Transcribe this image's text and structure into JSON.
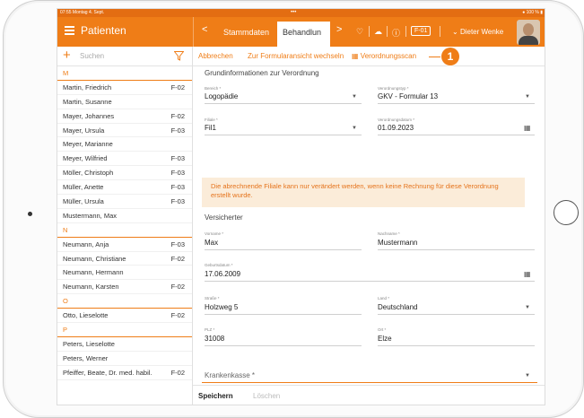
{
  "status": {
    "time_date": "07:55  Montag 4. Sept.",
    "dots": "•••",
    "battery": "100 %"
  },
  "app": {
    "title": "Patienten"
  },
  "nav": {
    "back": "<",
    "forward": ">",
    "tabs": [
      {
        "label": "Stammdaten"
      },
      {
        "label": "Behandlun"
      }
    ],
    "badge": "F-01",
    "user": "Dieter Wenke"
  },
  "search": {
    "placeholder": "Suchen"
  },
  "patients": [
    {
      "type": "letter",
      "name": "M"
    },
    {
      "name": "Martin, Friedrich",
      "code": "F-02"
    },
    {
      "name": "Martin, Susanne",
      "code": ""
    },
    {
      "name": "Mayer, Johannes",
      "code": "F-02"
    },
    {
      "name": "Mayer, Ursula",
      "code": "F-03"
    },
    {
      "name": "Meyer, Marianne",
      "code": ""
    },
    {
      "name": "Meyer, Wilfried",
      "code": "F-03"
    },
    {
      "name": "Möller, Christoph",
      "code": "F-03"
    },
    {
      "name": "Müller, Anette",
      "code": "F-03"
    },
    {
      "name": "Müller, Ursula",
      "code": "F-03"
    },
    {
      "name": "Mustermann, Max",
      "code": ""
    },
    {
      "type": "letter",
      "name": "N"
    },
    {
      "name": "Neumann, Anja",
      "code": "F-03"
    },
    {
      "name": "Neumann, Christiane",
      "code": "F-02"
    },
    {
      "name": "Neumann, Hermann",
      "code": ""
    },
    {
      "name": "Neumann, Karsten",
      "code": "F-02"
    },
    {
      "type": "letter",
      "name": "O"
    },
    {
      "name": "Otto, Lieselotte",
      "code": "F-02"
    },
    {
      "type": "letter",
      "name": "P"
    },
    {
      "name": "Peters, Lieselotte",
      "code": ""
    },
    {
      "name": "Peters, Werner",
      "code": ""
    },
    {
      "name": "Pfeiffer, Beate, Dr. med. habil.",
      "code": "F-02"
    }
  ],
  "toolbar": {
    "cancel": "Abbrechen",
    "switch_form": "Zur Formularansicht wechseln",
    "scan": "Verordnungsscan",
    "callout": "1"
  },
  "form": {
    "section_basic": "Grundinformationen zur Verordnung",
    "bereich": {
      "label": "Bereich *",
      "value": "Logopädie"
    },
    "typ": {
      "label": "Verordnungstyp *",
      "value": "GKV - Formular 13"
    },
    "filiale": {
      "label": "Filiale *",
      "value": "Fil1"
    },
    "datum": {
      "label": "Verordnungsdatum *",
      "value": "01.09.2023"
    },
    "warning": "Die abrechnende Filiale kann nur verändert werden, wenn keine Rechnung für diese Verordnung erstellt wurde.",
    "section_insured": "Versicherter",
    "vorname": {
      "label": "Vorname *",
      "value": "Max"
    },
    "nachname": {
      "label": "Nachname *",
      "value": "Mustermann"
    },
    "geburtsdatum": {
      "label": "Geburtsdatum *",
      "value": "17.06.2009"
    },
    "strasse": {
      "label": "Straße *",
      "value": "Holzweg 5"
    },
    "land": {
      "label": "Land *",
      "value": "Deutschland"
    },
    "plz": {
      "label": "PLZ *",
      "value": "31008"
    },
    "ort": {
      "label": "Ort *",
      "value": "Elze"
    },
    "krankenkasse": {
      "label": "Krankenkasse *"
    }
  },
  "footer": {
    "save": "Speichern",
    "delete": "Löschen"
  },
  "colors": {
    "accent": "#ef7d17",
    "warning_bg": "#fbecd9"
  }
}
